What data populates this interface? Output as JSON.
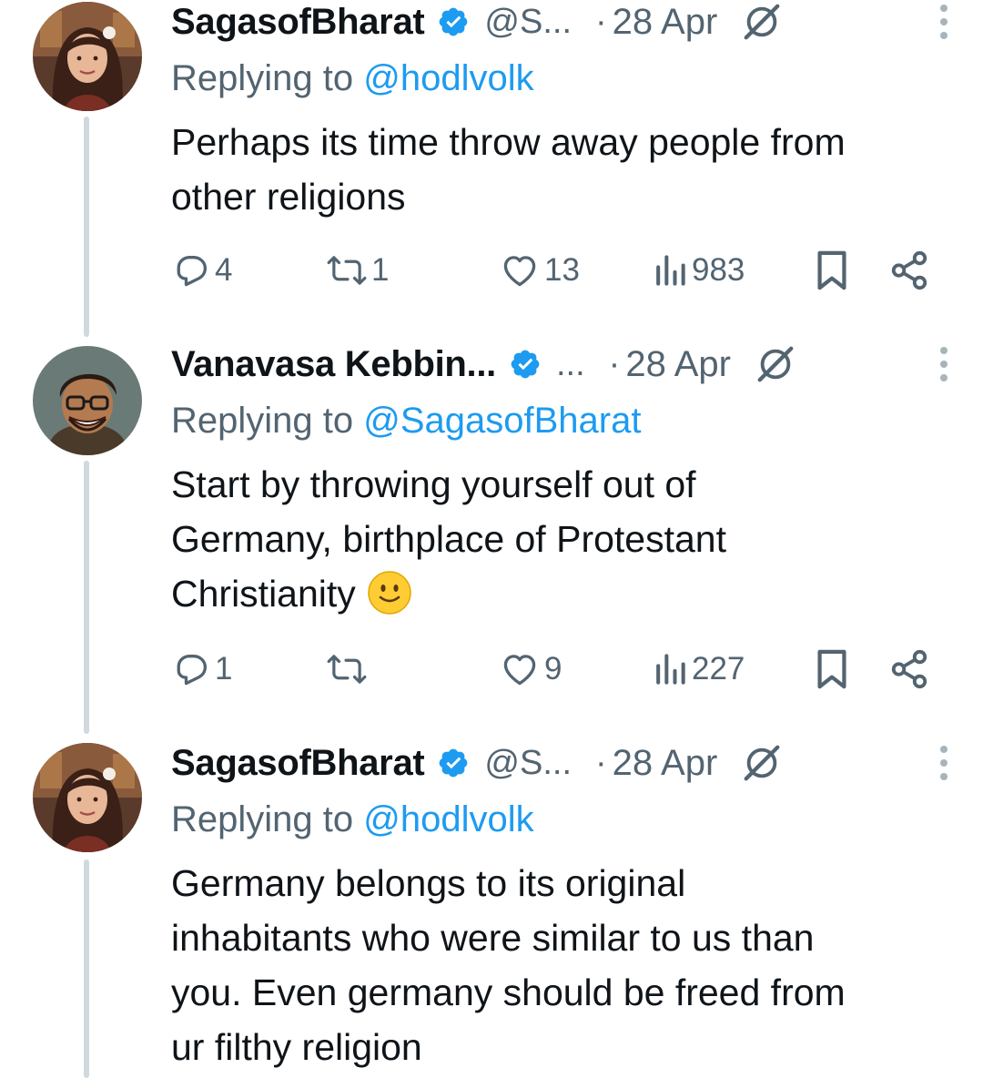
{
  "tweets": [
    {
      "name": "SagasofBharat",
      "handle": "@S...",
      "dot": "·",
      "date": "28 Apr",
      "replying_prefix": "Replying to ",
      "replying_to": "@hodlvolk",
      "text_lines": [
        "Perhaps its time throw away people from",
        "other religions"
      ],
      "replies": "4",
      "reposts": "1",
      "likes": "13",
      "views": "983"
    },
    {
      "name": "Vanavasa Kebbin...",
      "handle": "...",
      "dot": "·",
      "date": "28 Apr",
      "replying_prefix": "Replying to ",
      "replying_to": "@SagasofBharat",
      "text_lines": [
        "Start by throwing yourself out of",
        "Germany, birthplace of Protestant",
        "Christianity"
      ],
      "emoji": "slightly-smiling-face",
      "replies": "1",
      "reposts": "",
      "likes": "9",
      "views": "227"
    },
    {
      "name": "SagasofBharat",
      "handle": "@S...",
      "dot": "·",
      "date": "28 Apr",
      "replying_prefix": "Replying to ",
      "replying_to": "@hodlvolk",
      "text_lines": [
        "Germany belongs to its original",
        "inhabitants who were similar to us than",
        "you. Even germany should be freed from",
        "ur filthy religion"
      ]
    }
  ],
  "colors": {
    "text": "#0f1419",
    "secondary": "#536471",
    "link": "#1d9bf0",
    "verified": "#1d9bf0",
    "thread_line": "#cfd9de"
  },
  "icons": {
    "verified": "verified-badge-icon",
    "grok": "grok-icon",
    "more": "more-vertical-icon",
    "reply": "reply-icon",
    "repost": "repost-icon",
    "like": "heart-icon",
    "views": "views-icon",
    "bookmark": "bookmark-icon",
    "share": "share-icon"
  }
}
